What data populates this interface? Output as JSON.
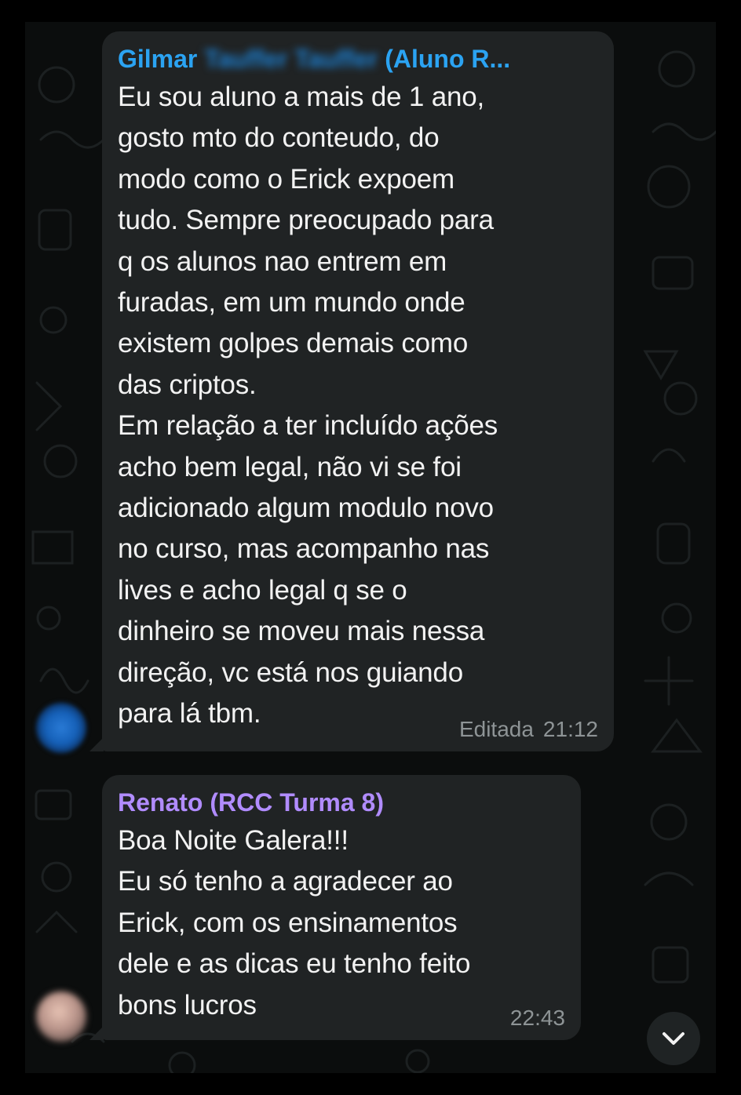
{
  "messages": [
    {
      "sender_visible": "Gilmar",
      "sender_blurred": "Tauffer Tauffer",
      "sender_suffix": "(Aluno R...",
      "text": "Eu sou aluno a mais de 1 ano,\ngosto mto do conteudo, do\nmodo como o Erick expoem\ntudo. Sempre preocupado para\nq os alunos nao entrem em\nfuradas, em um mundo onde\nexistem golpes demais como\ndas criptos.\nEm relação a ter incluído ações\nacho bem legal, não vi se foi\nadicionado algum modulo novo\nno curso, mas acompanho nas\nlives e acho legal q se o\ndinheiro se moveu mais nessa\ndireção, vc está nos guiando\npara lá tbm.",
      "edited_label": "Editada",
      "time": "21:12",
      "sender_color": "#2ba3f2"
    },
    {
      "sender": "Renato (RCC Turma 8)",
      "text": "Boa Noite Galera!!!\nEu só tenho a agradecer ao\nErick, com os ensinamentos\ndele e as dicas eu tenho feito\nbons lucros",
      "time": "22:43",
      "sender_color": "#b18cff"
    }
  ],
  "scroll_button": {
    "icon": "chevron-down-icon"
  },
  "colors": {
    "background": "#0b0d0d",
    "bubble": "#202324",
    "message_text": "#f2f2f2",
    "meta_text": "#8e9496"
  }
}
